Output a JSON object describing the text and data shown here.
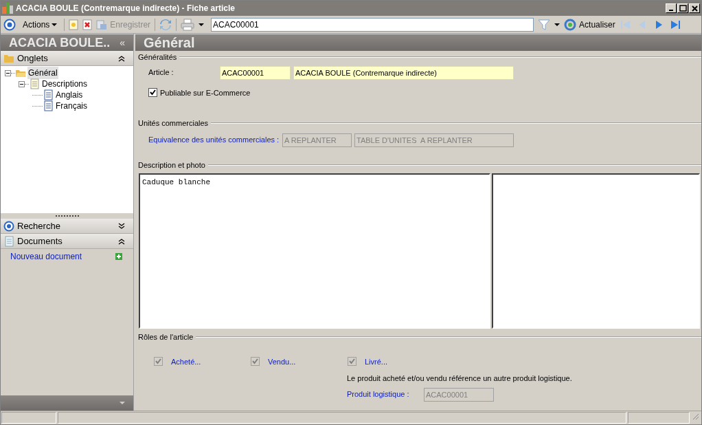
{
  "window": {
    "title": "ACACIA BOULE (Contremarque indirecte) -  Fiche article"
  },
  "toolbar": {
    "actions": "Actions",
    "save": {
      "label": "Enregistrer",
      "disabled": true
    },
    "search": {
      "value": "ACAC00001"
    },
    "refresh": "Actualiser",
    "nav": [
      {
        "kind": "first",
        "disabled": true
      },
      {
        "kind": "prev",
        "disabled": true
      },
      {
        "kind": "next",
        "disabled": false
      },
      {
        "kind": "last",
        "disabled": false
      }
    ]
  },
  "sidebar": {
    "title": "ACACIA BOULE..",
    "collapse": "«",
    "panels": [
      {
        "kind": "tabs",
        "label": "Onglets",
        "expanded": true,
        "tree": [
          {
            "label": "Général",
            "selected": true,
            "expanded": true,
            "kind": "folder",
            "children": [
              {
                "label": "Descriptions",
                "selected": false,
                "expanded": true,
                "kind": "doc",
                "children": [
                  {
                    "label": "Anglais",
                    "selected": false,
                    "kind": "page"
                  },
                  {
                    "label": "Français",
                    "selected": false,
                    "kind": "page"
                  }
                ]
              }
            ]
          }
        ]
      },
      {
        "kind": "search",
        "label": "Recherche",
        "expanded": false
      },
      {
        "kind": "docs",
        "label": "Documents",
        "expanded": true,
        "link": "Nouveau document"
      }
    ]
  },
  "content": {
    "title": "Général",
    "generalites": {
      "heading": "Généralités",
      "article_label": "Article :",
      "code": "ACAC00001",
      "name": "ACACIA BOULE (Contremarque indirecte)",
      "publish": {
        "label": "Publiable sur E-Commerce",
        "checked": true
      }
    },
    "unites": {
      "heading": "Unités commerciales",
      "label": "Equivalence des unités commerciales :",
      "code": "A REPLANTER",
      "name": "TABLE D'UNITES  A REPLANTER"
    },
    "description": {
      "heading": "Description et photo",
      "text": "Caduque blanche"
    },
    "roles": {
      "heading": "Rôles de l'article",
      "items": [
        {
          "label": "Acheté...",
          "checked": true
        },
        {
          "label": "Vendu...",
          "checked": true
        },
        {
          "label": "Livré...",
          "checked": true
        }
      ],
      "note": "Le produit acheté et/ou vendu référence un autre produit logistique.",
      "logistic_label": "Produit logistique :",
      "logistic_value": "ACAC00001"
    }
  }
}
